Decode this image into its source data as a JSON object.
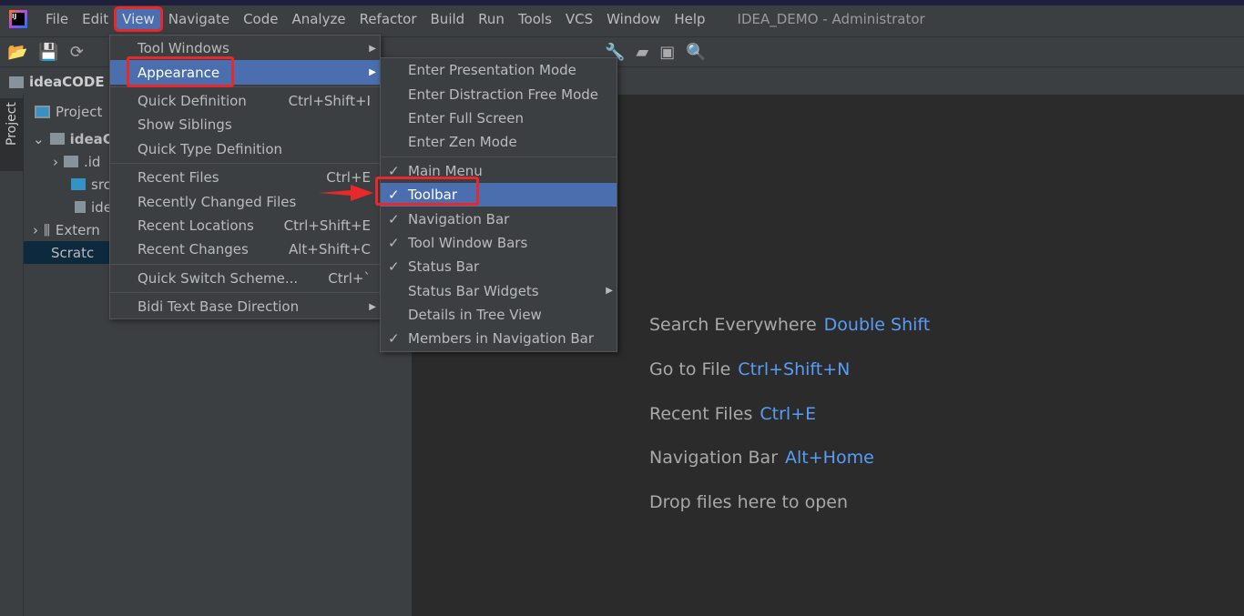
{
  "window": {
    "title": "IDEA_DEMO - Administrator"
  },
  "menubar": [
    "File",
    "Edit",
    "View",
    "Navigate",
    "Code",
    "Analyze",
    "Refactor",
    "Build",
    "Run",
    "Tools",
    "VCS",
    "Window",
    "Help"
  ],
  "navbar": {
    "project": "ideaCODE"
  },
  "sidebar": {
    "project_tab": "Project"
  },
  "panel": {
    "header": "Project",
    "tree": [
      "ideaC",
      "idea",
      ".id",
      "src",
      "ide",
      "Extern",
      "Scratc"
    ]
  },
  "view_menu": [
    {
      "label": "Tool Windows",
      "submenu": true
    },
    {
      "label": "Appearance",
      "submenu": true,
      "highlighted": true
    },
    {
      "sep": true
    },
    {
      "label": "Quick Definition",
      "shortcut": "Ctrl+Shift+I"
    },
    {
      "label": "Show Siblings"
    },
    {
      "label": "Quick Type Definition"
    },
    {
      "sep": true
    },
    {
      "label": "Recent Files",
      "shortcut": "Ctrl+E"
    },
    {
      "label": "Recently Changed Files"
    },
    {
      "label": "Recent Locations",
      "shortcut": "Ctrl+Shift+E"
    },
    {
      "label": "Recent Changes",
      "shortcut": "Alt+Shift+C"
    },
    {
      "sep": true
    },
    {
      "label": "Quick Switch Scheme...",
      "shortcut": "Ctrl+`"
    },
    {
      "sep": true
    },
    {
      "label": "Bidi Text Base Direction",
      "submenu": true
    }
  ],
  "appearance_menu": [
    {
      "label": "Enter Presentation Mode"
    },
    {
      "label": "Enter Distraction Free Mode"
    },
    {
      "label": "Enter Full Screen"
    },
    {
      "label": "Enter Zen Mode"
    },
    {
      "sep": true
    },
    {
      "label": "Main Menu",
      "checked": true
    },
    {
      "label": "Toolbar",
      "checked": true,
      "highlighted": true
    },
    {
      "label": "Navigation Bar",
      "checked": true
    },
    {
      "label": "Tool Window Bars",
      "checked": true
    },
    {
      "label": "Status Bar",
      "checked": true
    },
    {
      "label": "Status Bar Widgets",
      "submenu": true
    },
    {
      "label": "Details in Tree View"
    },
    {
      "label": "Members in Navigation Bar",
      "checked": true
    }
  ],
  "editor_hints": [
    {
      "label": "Search Everywhere",
      "key": "Double Shift"
    },
    {
      "label": "Go to File",
      "key": "Ctrl+Shift+N"
    },
    {
      "label": "Recent Files",
      "key": "Ctrl+E"
    },
    {
      "label": "Navigation Bar",
      "key": "Alt+Home"
    },
    {
      "label": "Drop files here to open",
      "key": ""
    }
  ],
  "colors": {
    "accent": "#4b6eaf",
    "annotation": "#e8282b",
    "link": "#589df6"
  }
}
